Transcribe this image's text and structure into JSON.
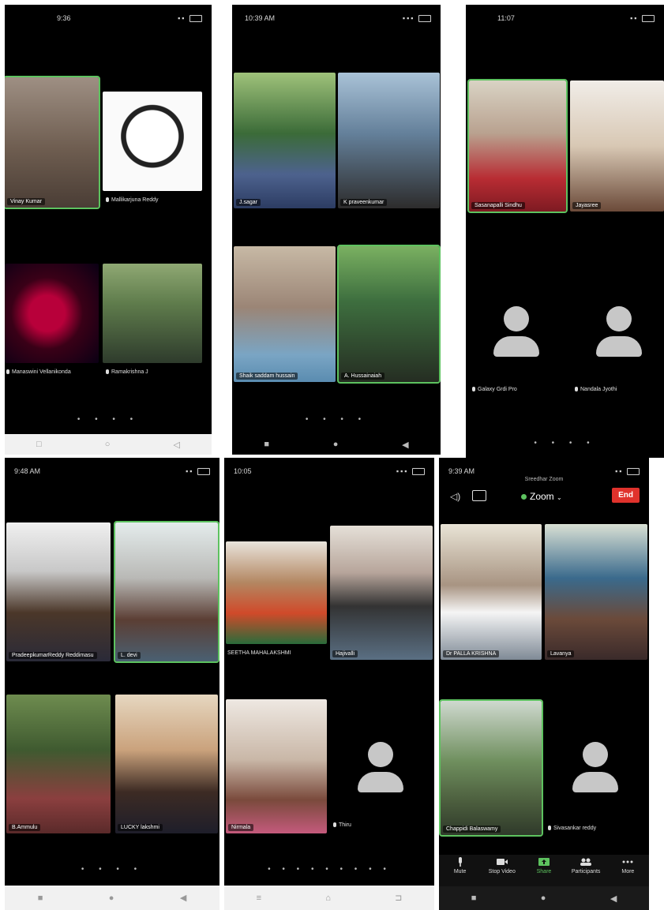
{
  "panels": [
    {
      "status_time": "9:36",
      "tiles": [
        {
          "name": "Vinay Kumar",
          "active": true
        },
        {
          "name": "Mallikarjuna Reddy",
          "active": false
        },
        {
          "name": "Manaswini Vellanikonda",
          "active": false
        },
        {
          "name": "Ramakrishna J",
          "active": false
        }
      ]
    },
    {
      "status_time": "10:39 AM",
      "tiles": [
        {
          "name": "J.sagar",
          "active": false
        },
        {
          "name": "K praveenkumar",
          "active": false
        },
        {
          "name": "Shaik saddam hussain",
          "active": false
        },
        {
          "name": "A. Hussainaiah",
          "active": true
        }
      ]
    },
    {
      "status_time": "11:07",
      "tiles": [
        {
          "name": "Sasanapalli Sindhu",
          "active": true
        },
        {
          "name": "Jayasree",
          "active": false
        },
        {
          "name": "Galaxy Grdi Pro",
          "active": false
        },
        {
          "name": "Nandala Jyothi",
          "active": false
        }
      ]
    },
    {
      "status_time": "9:48 AM",
      "tiles": [
        {
          "name": "PradeepkumarReddy Reddimasu",
          "active": false
        },
        {
          "name": "L. devi",
          "active": true
        },
        {
          "name": "B.Ammulu",
          "active": false
        },
        {
          "name": "LUCKY lakshmi",
          "active": false
        }
      ]
    },
    {
      "status_time": "10:05",
      "tiles": [
        {
          "name": "SEETHA MAHALAKSHMI",
          "active": false
        },
        {
          "name": "Hajivalli",
          "active": false
        },
        {
          "name": "Nirmala",
          "active": false
        },
        {
          "name": "Thiru",
          "active": false
        }
      ]
    },
    {
      "status_time": "9:39 AM",
      "meeting_title": "Sreedhar Zoom",
      "zoom_label": "Zoom",
      "end_label": "End",
      "tiles": [
        {
          "name": "Dr PALLA KRISHNA",
          "active": false
        },
        {
          "name": "Lavanya",
          "active": false
        },
        {
          "name": "Chappidi Balaswamy",
          "active": true
        },
        {
          "name": "Sivasankar reddy",
          "active": false
        }
      ],
      "toolbar": [
        "Mute",
        "Stop Video",
        "Share",
        "Participants",
        "More"
      ]
    }
  ],
  "page_dots": "• • • •",
  "page_dots_long": "• • • • • • • • •",
  "nav_light": [
    "□",
    "○",
    "◁"
  ],
  "nav_dark": [
    "■",
    "●",
    "◀"
  ],
  "nav_android": [
    "≡",
    "⌂",
    "⊐"
  ],
  "colors": {
    "active_border": "#5dc25f",
    "end_button": "#e0322c",
    "background": "#000000"
  }
}
